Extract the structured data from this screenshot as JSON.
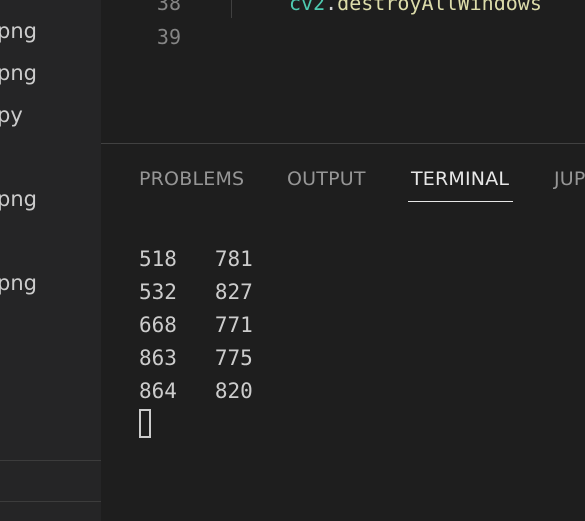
{
  "sidebar": {
    "items": [
      {
        "label": "png"
      },
      {
        "label": "png"
      },
      {
        "label": "py"
      },
      {
        "label": "png"
      },
      {
        "label": "png"
      }
    ]
  },
  "editor": {
    "lines": [
      {
        "number": "38",
        "tokens": [
          {
            "text": "cv2",
            "kind": "var"
          },
          {
            "text": ".",
            "kind": "punc"
          },
          {
            "text": "destroyAllWindows",
            "kind": "fn"
          }
        ]
      },
      {
        "number": "39",
        "tokens": []
      }
    ]
  },
  "panel": {
    "tabs": [
      {
        "label": "PROBLEMS",
        "active": false
      },
      {
        "label": "OUTPUT",
        "active": false
      },
      {
        "label": "TERMINAL",
        "active": true
      },
      {
        "label": "JUP",
        "active": false
      }
    ],
    "terminal": {
      "lines": [
        "518   781",
        "532   827",
        "668   771",
        "863   775",
        "864   820"
      ]
    }
  }
}
